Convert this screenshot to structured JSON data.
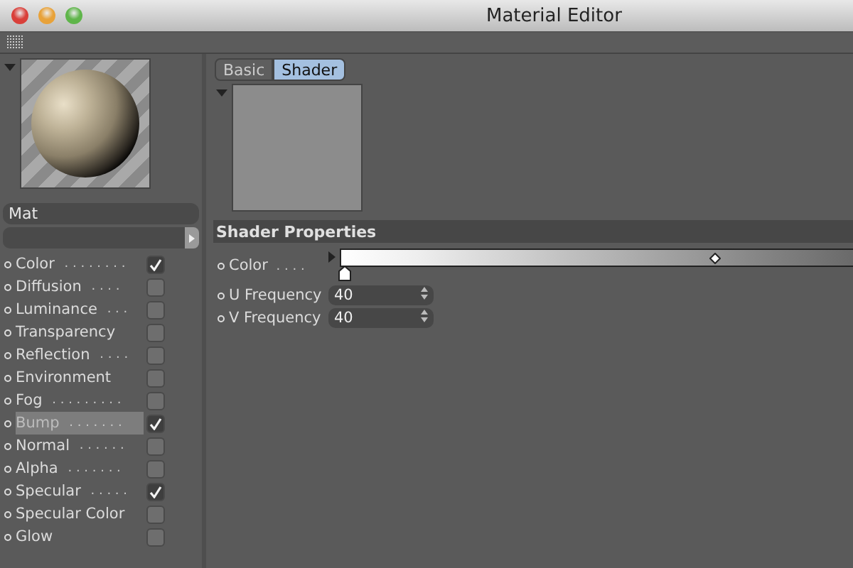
{
  "window": {
    "title": "Material Editor"
  },
  "material": {
    "name": "Mat"
  },
  "channels": [
    {
      "label": "Color",
      "dots": ". . . . . . . .",
      "checked": true,
      "selected": false
    },
    {
      "label": "Diffusion",
      "dots": ". . . .",
      "checked": false,
      "selected": false
    },
    {
      "label": "Luminance",
      "dots": ". . .",
      "checked": false,
      "selected": false
    },
    {
      "label": "Transparency",
      "checked": false,
      "selected": false
    },
    {
      "label": "Reflection",
      "dots": ". . . .",
      "checked": false,
      "selected": false
    },
    {
      "label": "Environment",
      "checked": false,
      "selected": false
    },
    {
      "label": "Fog",
      "dots": ". . . . . . . . .",
      "checked": false,
      "selected": false
    },
    {
      "label": "Bump",
      "dots": ". . . . . . .",
      "checked": true,
      "selected": true
    },
    {
      "label": "Normal",
      "dots": ". . . . . .",
      "checked": false,
      "selected": false
    },
    {
      "label": "Alpha",
      "dots": ". . . . . . .",
      "checked": false,
      "selected": false
    },
    {
      "label": "Specular",
      "dots": ". . . . .",
      "checked": true,
      "selected": false
    },
    {
      "label": "Specular Color",
      "checked": false,
      "selected": false
    },
    {
      "label": "Glow",
      "checked": false,
      "selected": false
    }
  ],
  "tabs": [
    {
      "label": "Basic",
      "selected": false
    },
    {
      "label": "Shader",
      "selected": true
    }
  ],
  "section": {
    "title": "Shader Properties"
  },
  "properties": [
    {
      "kind": "gradient",
      "label": "Color",
      "dots": ". . . ."
    },
    {
      "kind": "number",
      "label": "U Frequency",
      "value": "40"
    },
    {
      "kind": "number",
      "label": "V Frequency",
      "value": "40"
    }
  ]
}
